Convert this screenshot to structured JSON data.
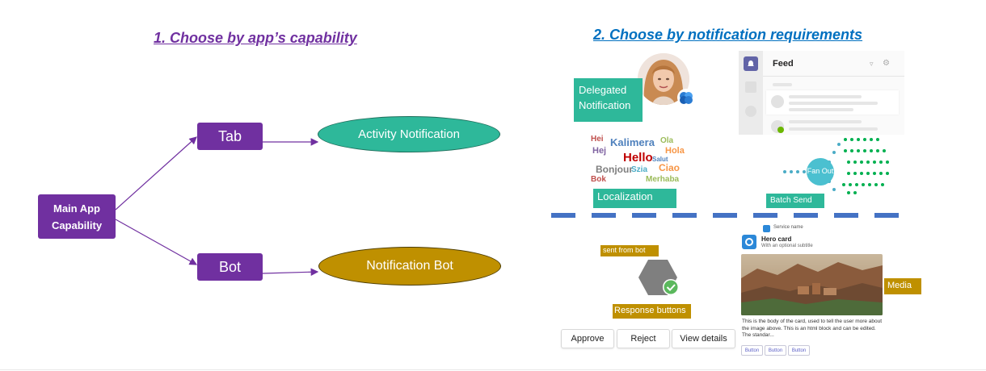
{
  "left": {
    "heading": "1. Choose by app’s capability",
    "main_box": "Main App Capability",
    "tab_box": "Tab",
    "bot_box": "Bot",
    "activity_notification": "Activity Notification",
    "notification_bot": "Notification Bot"
  },
  "right": {
    "heading": "2. Choose by notification requirements",
    "delegated_notification": "Delegated Notification",
    "feed_title": "Feed",
    "localization": "Localization",
    "fan_out": "Fan Out",
    "batch_send": "Batch Send",
    "sent_from": "sent from",
    "bot_word": "bot",
    "response_buttons": "Response buttons",
    "media": "Media",
    "buttons": [
      "Approve",
      "Reject",
      "View details"
    ],
    "card": {
      "service_name": "Service name",
      "title": "Hero card",
      "subtitle": "With an optional subtitle",
      "body": "This is the body of the card, used to tell the user more about the image above. This is an html block and can be edited. The standar...",
      "small_buttons": [
        "Button",
        "Button",
        "Button"
      ]
    },
    "word_cloud": [
      "Hei",
      "Kalimera",
      "Ola",
      "Hola",
      "Hello",
      "Hej",
      "Bonjour",
      "Szia",
      "Ciao",
      "Merhaba",
      "Salut",
      "Bok"
    ]
  },
  "colors": {
    "purple": "#7030a0",
    "teal": "#2eb89a",
    "gold": "#bf9000",
    "divider_blue": "#4472c4",
    "heading_blue": "#0070c0"
  }
}
